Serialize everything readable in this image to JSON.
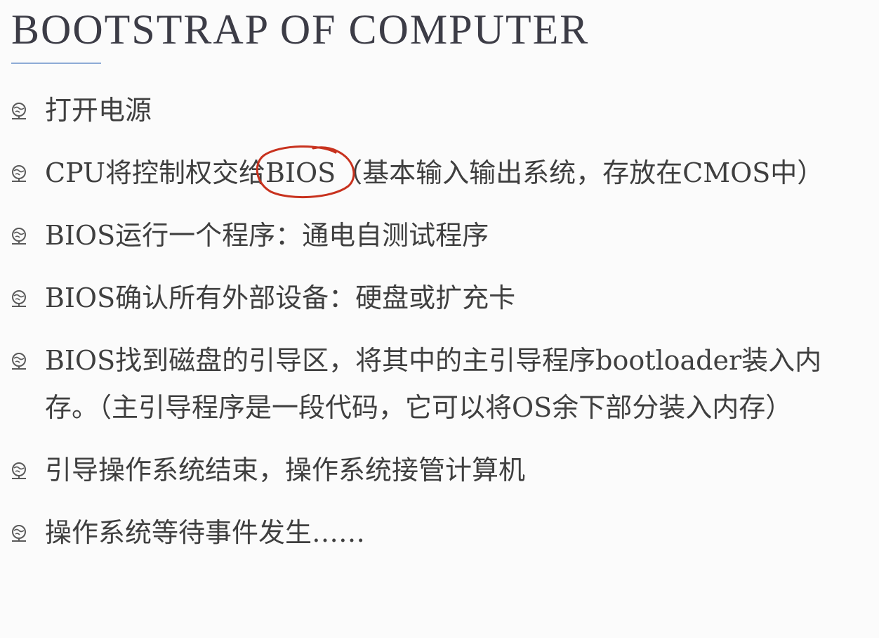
{
  "slide": {
    "title": "BOOTSTRAP OF COMPUTER",
    "bullets": [
      {
        "text": "打开电源"
      },
      {
        "pre": "CPU将控制权交给",
        "highlight": "BIOS",
        "post": "（基本输入输出系统，存放在CMOS中）"
      },
      {
        "text": "BIOS运行一个程序：通电自测试程序"
      },
      {
        "text": "BIOS确认所有外部设备：硬盘或扩充卡"
      },
      {
        "text": "BIOS找到磁盘的引导区，将其中的主引导程序bootloader装入内存。（主引导程序是一段代码，它可以将OS余下部分装入内存）"
      },
      {
        "text": "引导操作系统结束，操作系统接管计算机"
      },
      {
        "text": "操作系统等待事件发生……"
      }
    ]
  },
  "colors": {
    "text": "#3f3f3f",
    "title": "#3c3c46",
    "rule": "#8eabd6",
    "annotation": "#c8321e",
    "bullet_icon": "#5a5a5a"
  },
  "icons": {
    "bullet": "globe-pin-icon",
    "annotation": "red-hand-drawn-circle"
  }
}
